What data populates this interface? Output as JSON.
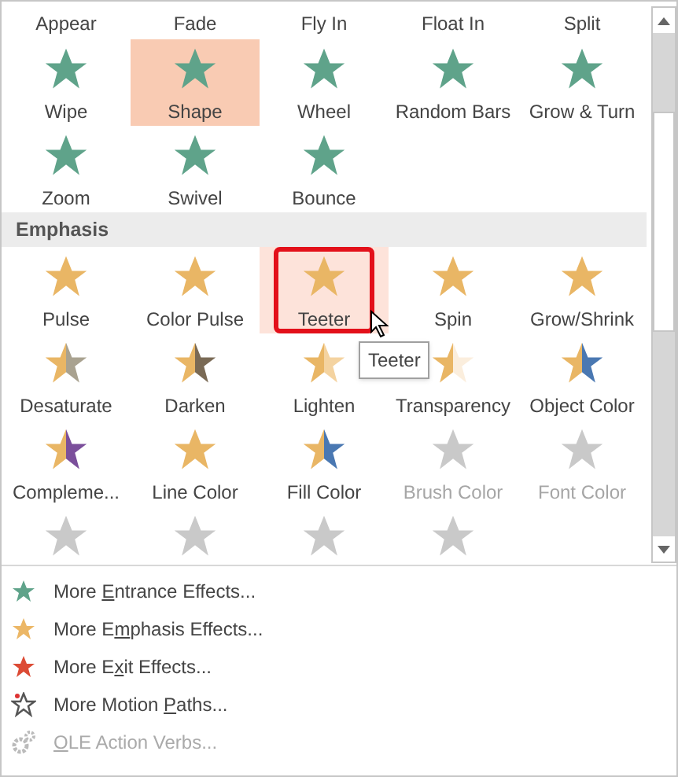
{
  "gallery": {
    "tooltip": "Teeter",
    "sections": [
      {
        "rows": [
          [
            {
              "kind": "label_only",
              "label": "Appear",
              "selected": false,
              "hovered": false,
              "disabled": false
            },
            {
              "kind": "label_only",
              "label": "Fade",
              "selected": false,
              "hovered": false,
              "disabled": false
            },
            {
              "kind": "label_only",
              "label": "Fly In",
              "selected": false,
              "hovered": false,
              "disabled": false
            },
            {
              "kind": "label_only",
              "label": "Float In",
              "selected": false,
              "hovered": false,
              "disabled": false
            },
            {
              "kind": "label_only",
              "label": "Split",
              "selected": false,
              "hovered": false,
              "disabled": false
            }
          ],
          [
            {
              "kind": "full",
              "label": "Wipe",
              "selected": false,
              "hovered": false,
              "disabled": false
            },
            {
              "kind": "full",
              "label": "Shape",
              "selected": true,
              "hovered": false,
              "disabled": false
            },
            {
              "kind": "full",
              "label": "Wheel",
              "selected": false,
              "hovered": false,
              "disabled": false
            },
            {
              "kind": "full",
              "label": "Random Bars",
              "selected": false,
              "hovered": false,
              "disabled": false
            },
            {
              "kind": "full",
              "label": "Grow & Turn",
              "selected": false,
              "hovered": false,
              "disabled": false
            }
          ],
          [
            {
              "kind": "full",
              "label": "Zoom",
              "selected": false,
              "hovered": false,
              "disabled": false
            },
            {
              "kind": "full",
              "label": "Swivel",
              "selected": false,
              "hovered": false,
              "disabled": false
            },
            {
              "kind": "full",
              "label": "Bounce",
              "selected": false,
              "hovered": false,
              "disabled": false
            }
          ]
        ]
      },
      {
        "header": "Emphasis",
        "rows": [
          [
            {
              "kind": "full",
              "label": "Pulse",
              "selected": false,
              "hovered": false,
              "disabled": false
            },
            {
              "kind": "full",
              "label": "Color Pulse",
              "selected": false,
              "hovered": false,
              "disabled": false
            },
            {
              "kind": "full",
              "label": "Teeter",
              "selected": false,
              "hovered": true,
              "disabled": false
            },
            {
              "kind": "full",
              "label": "Spin",
              "selected": false,
              "hovered": false,
              "disabled": false
            },
            {
              "kind": "full",
              "label": "Grow/Shrink",
              "selected": false,
              "hovered": false,
              "disabled": false
            }
          ],
          [
            {
              "kind": "full",
              "label": "Desaturate",
              "selected": false,
              "hovered": false,
              "disabled": false
            },
            {
              "kind": "full",
              "label": "Darken",
              "selected": false,
              "hovered": false,
              "disabled": false
            },
            {
              "kind": "full",
              "label": "Lighten",
              "selected": false,
              "hovered": false,
              "disabled": false
            },
            {
              "kind": "full",
              "label": "Transparency",
              "selected": false,
              "hovered": false,
              "disabled": false
            },
            {
              "kind": "full",
              "label": "Object Color",
              "selected": false,
              "hovered": false,
              "disabled": false
            }
          ],
          [
            {
              "kind": "full",
              "label": "Compleme...",
              "selected": false,
              "hovered": false,
              "disabled": false
            },
            {
              "kind": "full",
              "label": "Line Color",
              "selected": false,
              "hovered": false,
              "disabled": false
            },
            {
              "kind": "full",
              "label": "Fill Color",
              "selected": false,
              "hovered": false,
              "disabled": false
            },
            {
              "kind": "full",
              "label": "Brush Color",
              "selected": false,
              "hovered": false,
              "disabled": true
            },
            {
              "kind": "full",
              "label": "Font Color",
              "selected": false,
              "hovered": false,
              "disabled": true
            }
          ],
          [
            {
              "kind": "icon_only",
              "selected": false,
              "hovered": false,
              "disabled": true
            },
            {
              "kind": "icon_only",
              "selected": false,
              "hovered": false,
              "disabled": true
            },
            {
              "kind": "icon_only",
              "selected": false,
              "hovered": false,
              "disabled": true
            },
            {
              "kind": "icon_only",
              "selected": false,
              "hovered": false,
              "disabled": true
            }
          ]
        ]
      }
    ]
  },
  "menu": [
    {
      "kind": "star",
      "color": "#5fa38a",
      "before": "More ",
      "access_key": "E",
      "after": "ntrance Effects...",
      "disabled": false
    },
    {
      "kind": "star",
      "color": "#ecb766",
      "before": "More E",
      "access_key": "m",
      "after": "phasis Effects...",
      "disabled": false
    },
    {
      "kind": "star",
      "color": "#dc4b35",
      "before": "More E",
      "access_key": "x",
      "after": "it Effects...",
      "disabled": false
    },
    {
      "kind": "outline_star",
      "before": "More Motion ",
      "access_key": "P",
      "after": "aths...",
      "disabled": false
    },
    {
      "kind": "gears",
      "access_key": "O",
      "after": "LE Action Verbs...",
      "disabled": true
    }
  ]
}
